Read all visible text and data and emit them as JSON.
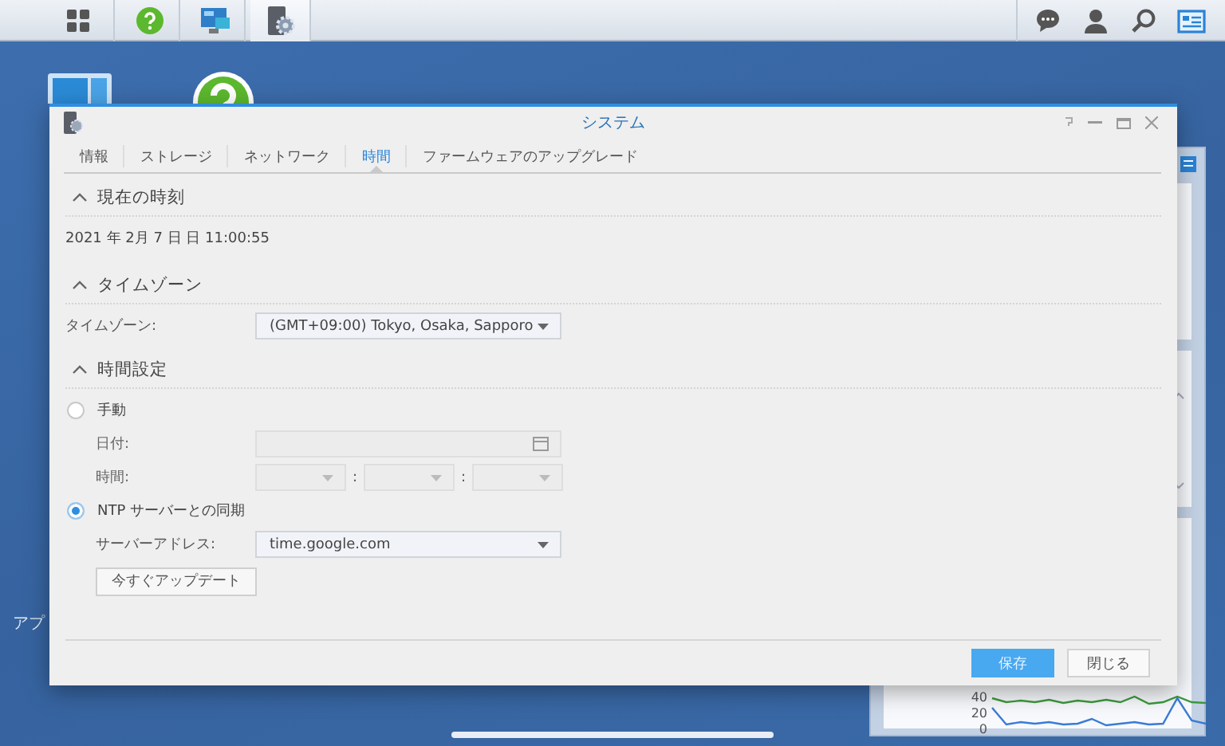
{
  "taskbar": {
    "left_buttons": [
      {
        "kind": "menu",
        "selected": false
      },
      {
        "kind": "help",
        "selected": false
      },
      {
        "kind": "monitor",
        "selected": false
      },
      {
        "kind": "settings",
        "selected": true
      }
    ],
    "right_buttons": [
      {
        "kind": "chat"
      },
      {
        "kind": "user"
      },
      {
        "kind": "search"
      },
      {
        "kind": "widgets"
      }
    ]
  },
  "desktop": {
    "icons": [
      {
        "kind": "monitor"
      },
      {
        "kind": "help"
      }
    ],
    "label": "アプ"
  },
  "widget_panel": {
    "chart_data": {
      "type": "line",
      "ylim": [
        0,
        40
      ],
      "yticks": [
        0,
        20,
        40
      ],
      "series": [
        {
          "color": "#3c9a3c",
          "values": [
            38,
            33,
            35,
            33,
            36,
            32,
            35,
            33,
            36,
            33,
            40,
            31,
            33,
            40,
            33,
            32
          ]
        },
        {
          "color": "#3a7bd5",
          "values": [
            26,
            5,
            8,
            6,
            8,
            5,
            6,
            12,
            4,
            6,
            8,
            5,
            6,
            38,
            10,
            6
          ]
        }
      ]
    }
  },
  "window": {
    "title": "システム",
    "tabs": [
      {
        "label": "情報",
        "selected": false
      },
      {
        "label": "ストレージ",
        "selected": false
      },
      {
        "label": "ネットワーク",
        "selected": false
      },
      {
        "label": "時間",
        "selected": true
      },
      {
        "label": "ファームウェアのアップグレード",
        "selected": false
      }
    ],
    "sections": [
      {
        "title": "現在の時刻",
        "expanded": true,
        "rows": [
          {
            "kind": "text",
            "text": "2021 年 2月 7 日 日 11:00:55"
          }
        ]
      },
      {
        "title": "タイムゾーン",
        "expanded": true,
        "rows": [
          {
            "kind": "select",
            "label": "タイムゾーン:",
            "value": "(GMT+09:00) Tokyo, Osaka, Sapporo",
            "disabled": false
          }
        ]
      },
      {
        "title": "時間設定",
        "expanded": true,
        "rows": [
          {
            "kind": "radio",
            "label": "手動",
            "selected": false,
            "children": [
              {
                "kind": "date",
                "label": "日付:",
                "disabled": true
              },
              {
                "kind": "time",
                "label": "時間:",
                "disabled": true,
                "separators": [
                  ":",
                  ":"
                ]
              }
            ]
          },
          {
            "kind": "radio",
            "label": "NTP サーバーとの同期",
            "selected": true,
            "children": [
              {
                "kind": "select",
                "label": "サーバーアドレス:",
                "value": "time.google.com",
                "disabled": false
              },
              {
                "kind": "button",
                "label": "今すぐアップデート"
              }
            ]
          }
        ]
      }
    ],
    "footer_buttons": [
      {
        "kind": "primary",
        "label": "保存"
      },
      {
        "kind": "secondary",
        "label": "閉じる"
      }
    ]
  }
}
